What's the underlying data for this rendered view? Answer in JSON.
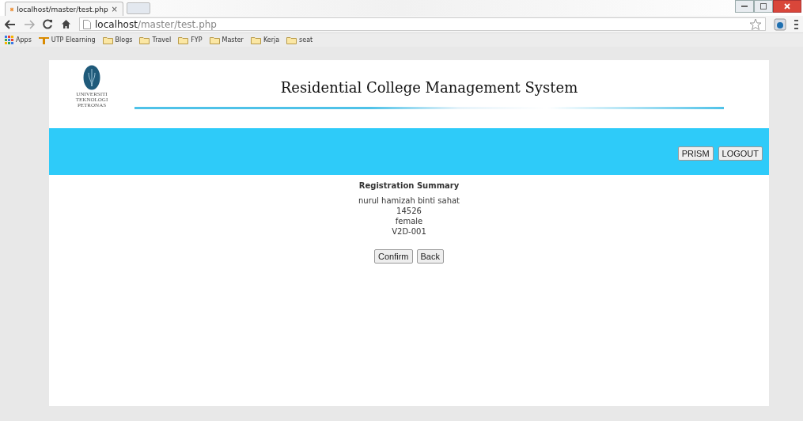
{
  "browser": {
    "tab": {
      "title": "localhost/master/test.php",
      "close": "×"
    },
    "address": {
      "host": "localhost",
      "path": "/master/test.php"
    },
    "bookmarks": [
      {
        "label": "Apps",
        "kind": "apps"
      },
      {
        "label": "UTP Elearning",
        "kind": "site"
      },
      {
        "label": "Blogs",
        "kind": "folder"
      },
      {
        "label": "Travel",
        "kind": "folder"
      },
      {
        "label": "FYP",
        "kind": "folder"
      },
      {
        "label": "Master",
        "kind": "folder"
      },
      {
        "label": "Kerja",
        "kind": "folder"
      },
      {
        "label": "seat",
        "kind": "folder"
      }
    ]
  },
  "header": {
    "logo_text": [
      "UNIVERSITI",
      "TEKNOLOGI",
      "PETRONAS"
    ],
    "title": "Residential College Management System"
  },
  "nav_buttons": [
    "PRISM",
    "LOGOUT"
  ],
  "summary": {
    "heading": "Registration Summary",
    "lines": [
      "nurul hamizah binti sahat",
      "14526",
      "female",
      "V2D-001"
    ]
  },
  "actions": [
    "Confirm",
    "Back"
  ]
}
